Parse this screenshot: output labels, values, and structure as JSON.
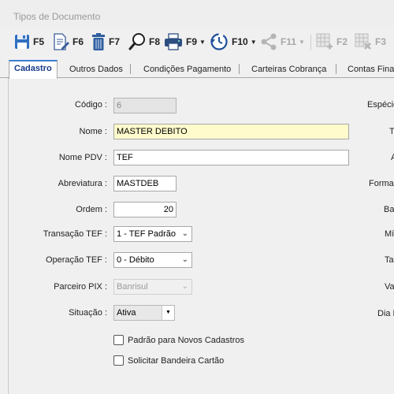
{
  "window": {
    "title": "Tipos de Documento"
  },
  "toolbar": {
    "save": "F5",
    "edit": "F6",
    "delete": "F7",
    "search": "F8",
    "print": "F9",
    "history": "F10",
    "share": "F11",
    "grid_add": "F2",
    "grid_remove": "F3"
  },
  "tabs": [
    "Cadastro",
    "Outros Dados",
    "Condições Pagamento",
    "Carteiras Cobrança",
    "Contas Finan"
  ],
  "form": {
    "codigo": {
      "label": "Código :",
      "value": "6"
    },
    "nome": {
      "label": "Nome :",
      "value": "MASTER DEBITO"
    },
    "nome_pdv": {
      "label": "Nome PDV :",
      "value": "TEF"
    },
    "abreviatura": {
      "label": "Abreviatura :",
      "value": "MASTDEB"
    },
    "ordem": {
      "label": "Ordem :",
      "value": "20"
    },
    "transacao_tef": {
      "label": "Transação TEF :",
      "value": "1 - TEF Padrão"
    },
    "operacao_tef": {
      "label": "Operação TEF :",
      "value": "0 - Débito"
    },
    "parceiro_pix": {
      "label": "Parceiro PIX :",
      "value": "Banrisul"
    },
    "situacao": {
      "label": "Situação :",
      "value": "Ativa"
    },
    "padrao_novos": {
      "label": "Padrão para Novos Cadastros",
      "checked": false
    },
    "solicitar_bandeira": {
      "label": "Solicitar Bandeira Cartão",
      "checked": false
    }
  },
  "right_labels": [
    "Espécie",
    "T",
    "A",
    "Forma",
    "Ba",
    "Mí",
    "Ta",
    "Va",
    "Dia F"
  ]
}
